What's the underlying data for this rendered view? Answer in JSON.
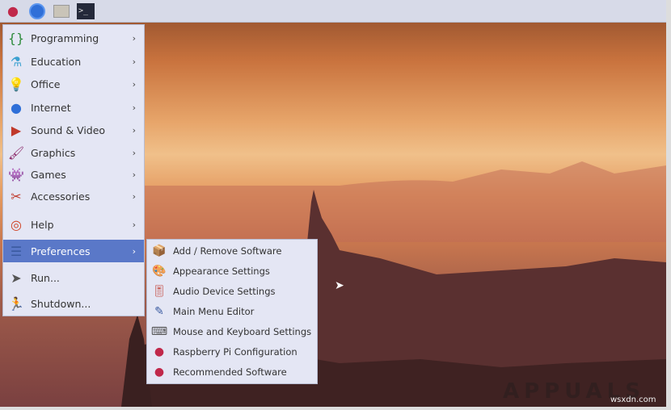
{
  "panel": {
    "icons": [
      "raspberry-menu-icon",
      "web-browser-icon",
      "file-manager-icon",
      "terminal-icon"
    ]
  },
  "menu": {
    "items": [
      {
        "label": "Programming",
        "icon": "programming-icon",
        "submenu": true
      },
      {
        "label": "Education",
        "icon": "education-flask-icon",
        "submenu": true
      },
      {
        "label": "Office",
        "icon": "office-lamp-icon",
        "submenu": true
      },
      {
        "label": "Internet",
        "icon": "globe-icon",
        "submenu": true
      },
      {
        "label": "Sound & Video",
        "icon": "sound-video-icon",
        "submenu": true
      },
      {
        "label": "Graphics",
        "icon": "paintbrush-icon",
        "submenu": true
      },
      {
        "label": "Games",
        "icon": "games-icon",
        "submenu": true
      },
      {
        "label": "Accessories",
        "icon": "accessories-icon",
        "submenu": true
      },
      {
        "label": "Help",
        "icon": "help-lifebuoy-icon",
        "submenu": true
      },
      {
        "label": "Preferences",
        "icon": "preferences-icon",
        "submenu": true,
        "highlighted": true
      },
      {
        "label": "Run...",
        "icon": "run-icon",
        "submenu": false
      },
      {
        "label": "Shutdown...",
        "icon": "shutdown-icon",
        "submenu": false
      }
    ]
  },
  "submenu": {
    "items": [
      {
        "label": "Add / Remove Software",
        "icon": "package-icon"
      },
      {
        "label": "Appearance Settings",
        "icon": "appearance-icon"
      },
      {
        "label": "Audio Device Settings",
        "icon": "audio-icon"
      },
      {
        "label": "Main Menu Editor",
        "icon": "menu-editor-icon"
      },
      {
        "label": "Mouse and Keyboard Settings",
        "icon": "keyboard-icon"
      },
      {
        "label": "Raspberry Pi Configuration",
        "icon": "raspberry-icon"
      },
      {
        "label": "Recommended Software",
        "icon": "raspberry-icon"
      }
    ]
  },
  "watermark": {
    "brand": "APPUALS",
    "site": "wsxdn.com"
  },
  "colors": {
    "highlight": "#5a78c8",
    "menu_bg": "#e4e6f4"
  }
}
